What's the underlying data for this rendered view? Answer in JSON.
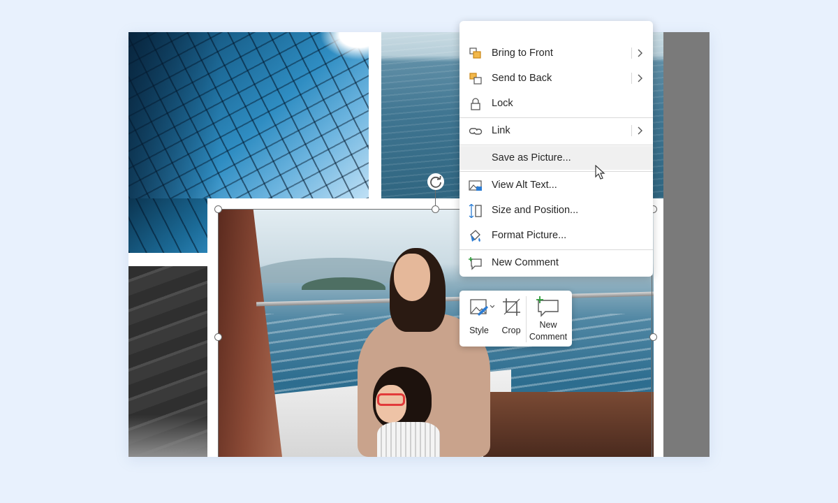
{
  "menu": {
    "items": [
      {
        "id": "bring-to-front",
        "label": "Bring to Front",
        "has_submenu": true,
        "icon": "bring-to-front-icon"
      },
      {
        "id": "send-to-back",
        "label": "Send to Back",
        "has_submenu": true,
        "icon": "send-to-back-icon"
      },
      {
        "id": "lock",
        "label": "Lock",
        "has_submenu": false,
        "icon": "lock-icon"
      },
      {
        "id": "link",
        "label": "Link",
        "has_submenu": true,
        "icon": "link-icon"
      },
      {
        "id": "save-as-picture",
        "label": "Save as Picture...",
        "has_submenu": false,
        "icon": "",
        "hovered": true
      },
      {
        "id": "view-alt-text",
        "label": "View Alt Text...",
        "has_submenu": false,
        "icon": "alt-text-icon"
      },
      {
        "id": "size-and-position",
        "label": "Size and Position...",
        "has_submenu": false,
        "icon": "size-position-icon"
      },
      {
        "id": "format-picture",
        "label": "Format Picture...",
        "has_submenu": false,
        "icon": "format-picture-icon"
      },
      {
        "id": "new-comment",
        "label": "New Comment",
        "has_submenu": false,
        "icon": "new-comment-icon"
      }
    ]
  },
  "mini_toolbar": {
    "style_label": "Style",
    "crop_label": "Crop",
    "comment_label_line1": "New",
    "comment_label_line2": "Comment"
  },
  "colors": {
    "page_background": "#e8f1fd",
    "menu_background": "#ffffff",
    "menu_hover": "#f0f0f0",
    "accent_orange": "#e8a33a",
    "accent_blue": "#2b7cd3",
    "accent_green": "#2e9b3a"
  }
}
